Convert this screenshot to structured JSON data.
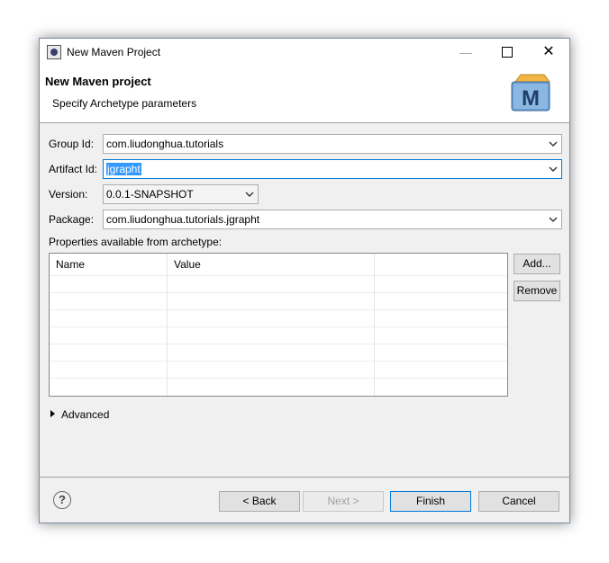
{
  "window": {
    "title": "New Maven Project",
    "close_glyph": "✕"
  },
  "banner": {
    "title": "New Maven project",
    "subtitle": "Specify Archetype parameters",
    "logo_letter": "M"
  },
  "form": {
    "group_id": {
      "label": "Group Id:",
      "value": "com.liudonghua.tutorials"
    },
    "artifact_id": {
      "label": "Artifact Id:",
      "value": "jgrapht"
    },
    "version": {
      "label": "Version:",
      "value": "0.0.1-SNAPSHOT"
    },
    "package": {
      "label": "Package:",
      "value": "com.liudonghua.tutorials.jgrapht"
    }
  },
  "properties": {
    "label": "Properties available from archetype:",
    "columns": [
      "Name",
      "Value"
    ],
    "rows": []
  },
  "side_buttons": {
    "add": "Add...",
    "remove": "Remove"
  },
  "advanced": {
    "label": "Advanced"
  },
  "footer": {
    "help": "?",
    "back": "< Back",
    "next": "Next >",
    "finish": "Finish",
    "cancel": "Cancel"
  },
  "colors": {
    "selection": "#3399ff",
    "focus_border": "#0078d7",
    "logo_blue": "#4a7fb5"
  }
}
